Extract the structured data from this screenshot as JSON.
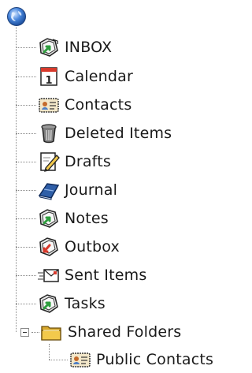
{
  "tree": {
    "root": {
      "icon": "globe-icon"
    },
    "items": [
      {
        "label": "INBOX",
        "icon": "inbox-folder-icon"
      },
      {
        "label": "Calendar",
        "icon": "calendar-icon",
        "icon_text": "1"
      },
      {
        "label": "Contacts",
        "icon": "contacts-card-icon"
      },
      {
        "label": "Deleted Items",
        "icon": "trash-can-icon"
      },
      {
        "label": "Drafts",
        "icon": "drafts-pencil-icon"
      },
      {
        "label": "Journal",
        "icon": "journal-book-icon"
      },
      {
        "label": "Notes",
        "icon": "notes-folder-icon"
      },
      {
        "label": "Outbox",
        "icon": "outbox-folder-icon"
      },
      {
        "label": "Sent Items",
        "icon": "sent-envelope-icon"
      },
      {
        "label": "Tasks",
        "icon": "tasks-folder-icon"
      },
      {
        "label": "Shared Folders",
        "icon": "shared-folder-icon",
        "expanded": true,
        "children": [
          {
            "label": "Public Contacts",
            "icon": "contacts-card-icon"
          }
        ]
      }
    ]
  },
  "colors": {
    "connector": "#8a8a8a",
    "folder_yellow": "#f2c94c",
    "arrow_green": "#2e9e3e",
    "arrow_red": "#d83a2c",
    "globe_blue": "#2f6fc4"
  }
}
